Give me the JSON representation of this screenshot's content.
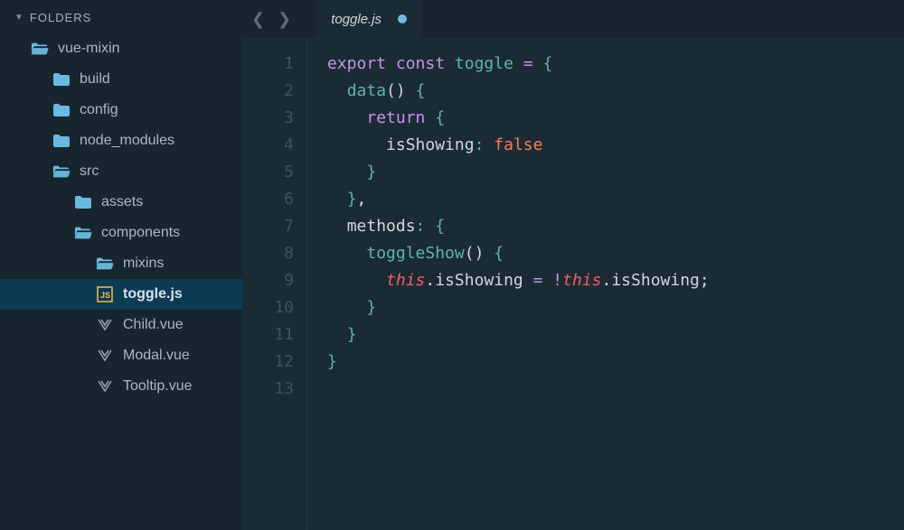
{
  "sidebar": {
    "header": "FOLDERS",
    "tree": [
      {
        "depth": 0,
        "icon": "folder-open",
        "label": "vue-mixin",
        "selected": false
      },
      {
        "depth": 1,
        "icon": "folder",
        "label": "build",
        "selected": false
      },
      {
        "depth": 1,
        "icon": "folder",
        "label": "config",
        "selected": false
      },
      {
        "depth": 1,
        "icon": "folder",
        "label": "node_modules",
        "selected": false
      },
      {
        "depth": 1,
        "icon": "folder-open",
        "label": "src",
        "selected": false
      },
      {
        "depth": 2,
        "icon": "folder",
        "label": "assets",
        "selected": false
      },
      {
        "depth": 2,
        "icon": "folder-open",
        "label": "components",
        "selected": false
      },
      {
        "depth": 3,
        "icon": "folder-open",
        "label": "mixins",
        "selected": false
      },
      {
        "depth": 4,
        "icon": "js",
        "label": "toggle.js",
        "selected": true
      },
      {
        "depth": 3,
        "icon": "vue",
        "label": "Child.vue",
        "selected": false
      },
      {
        "depth": 3,
        "icon": "vue",
        "label": "Modal.vue",
        "selected": false
      },
      {
        "depth": 3,
        "icon": "vue",
        "label": "Tooltip.vue",
        "selected": false
      }
    ]
  },
  "tab": {
    "title": "toggle.js",
    "dirty": true
  },
  "code": {
    "line_count": 13,
    "tokens": [
      [
        [
          "kw",
          "export "
        ],
        [
          "kw",
          "const "
        ],
        [
          "fn",
          "toggle "
        ],
        [
          "op",
          "= "
        ],
        [
          "punc",
          "{"
        ]
      ],
      [
        [
          "sp",
          "  "
        ],
        [
          "fn",
          "data"
        ],
        [
          "paren",
          "()"
        ],
        [
          "white",
          " "
        ],
        [
          "punc",
          "{"
        ]
      ],
      [
        [
          "sp",
          "    "
        ],
        [
          "kw",
          "return "
        ],
        [
          "punc",
          "{"
        ]
      ],
      [
        [
          "sp",
          "      "
        ],
        [
          "prop",
          "isShowing"
        ],
        [
          "colon",
          ": "
        ],
        [
          "bool",
          "false"
        ]
      ],
      [
        [
          "sp",
          "    "
        ],
        [
          "punc",
          "}"
        ]
      ],
      [
        [
          "sp",
          "  "
        ],
        [
          "punc",
          "}"
        ],
        [
          "white",
          ","
        ]
      ],
      [
        [
          "sp",
          "  "
        ],
        [
          "prop",
          "methods"
        ],
        [
          "colon",
          ": "
        ],
        [
          "punc",
          "{"
        ]
      ],
      [
        [
          "sp",
          "    "
        ],
        [
          "fn",
          "toggleShow"
        ],
        [
          "paren",
          "()"
        ],
        [
          "white",
          " "
        ],
        [
          "punc",
          "{"
        ]
      ],
      [
        [
          "sp",
          "      "
        ],
        [
          "this",
          "this"
        ],
        [
          "white",
          "."
        ],
        [
          "prop",
          "isShowing "
        ],
        [
          "op",
          "= "
        ],
        [
          "op",
          "!"
        ],
        [
          "this",
          "this"
        ],
        [
          "white",
          "."
        ],
        [
          "prop",
          "isShowing"
        ],
        [
          "white",
          ";"
        ]
      ],
      [
        [
          "sp",
          "    "
        ],
        [
          "punc",
          "}"
        ]
      ],
      [
        [
          "sp",
          "  "
        ],
        [
          "punc",
          "}"
        ]
      ],
      [
        [
          "punc",
          "}"
        ]
      ],
      []
    ]
  },
  "colors": {
    "bg": "#1a2b34",
    "sidebar": "#17262e",
    "accent": "#6bb9e0",
    "folder": "#6bb9e0",
    "js_border": "#f3c04b",
    "vue": "#8fa1ad"
  }
}
